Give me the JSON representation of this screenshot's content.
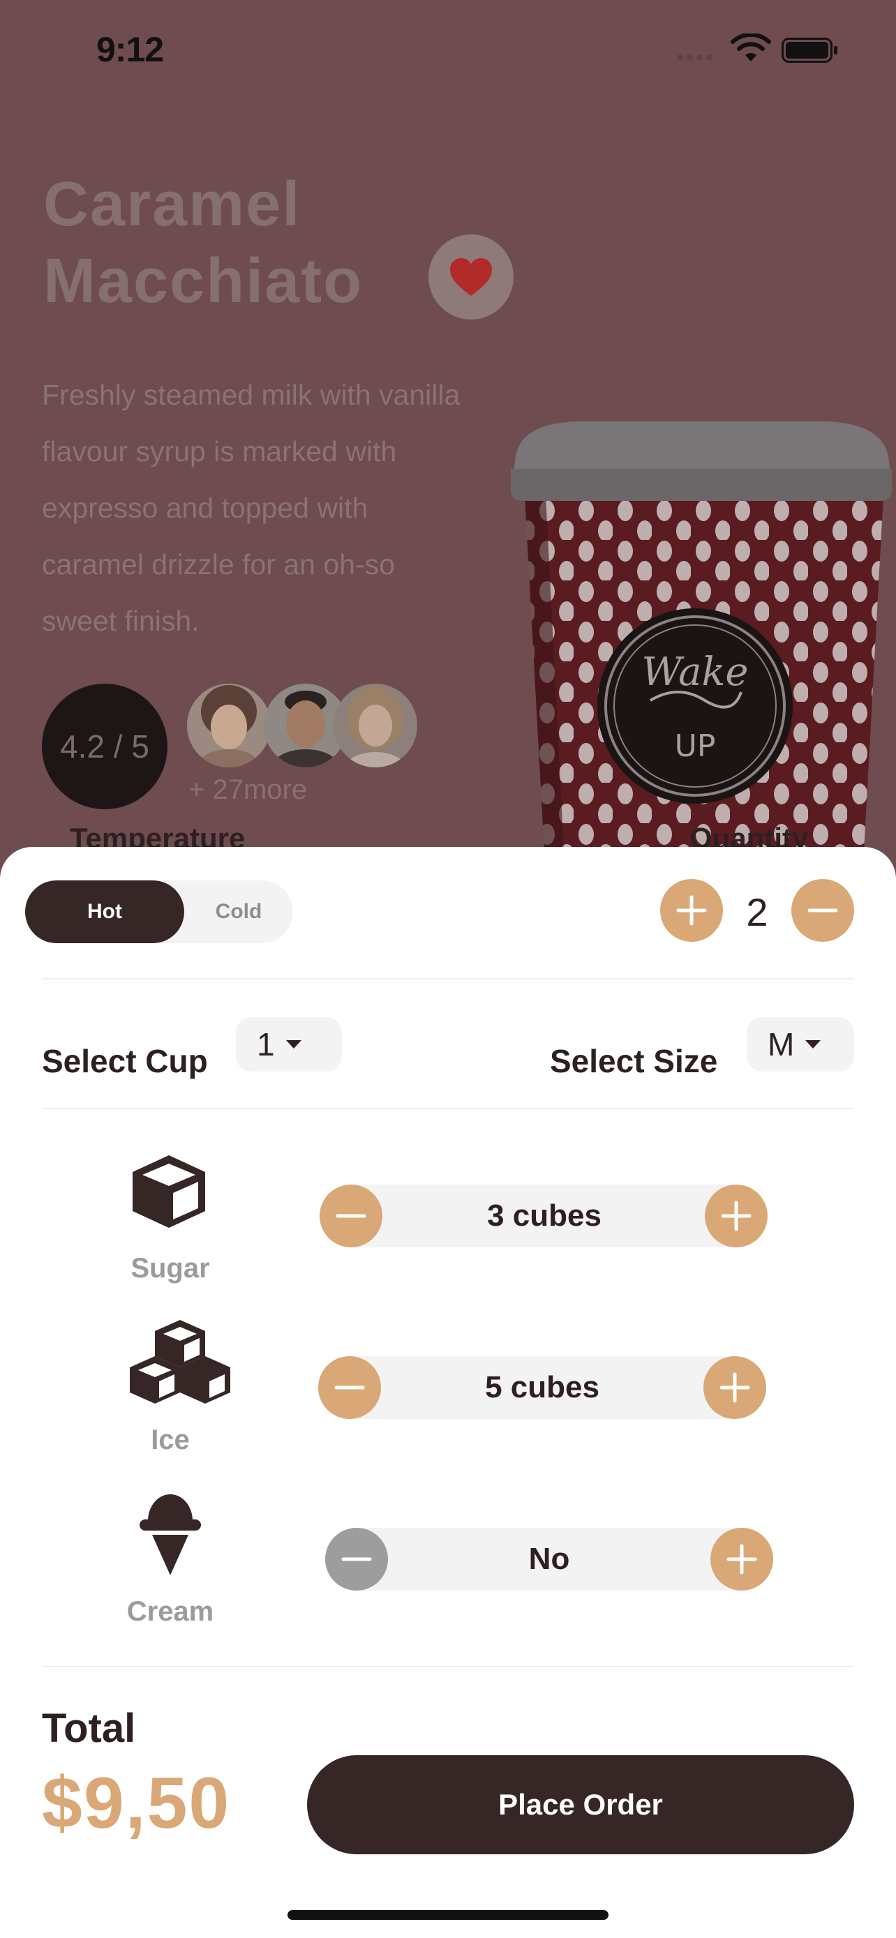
{
  "status_bar": {
    "time": "9:12"
  },
  "product": {
    "title_line1": "Caramel",
    "title_line2": "Macchiato",
    "description": "Freshly steamed milk with vanilla flavour syrup is marked with expresso and topped with caramel drizzle for an oh-so sweet finish.",
    "rating": "4.2 / 5",
    "reviewers_more": "+ 27more",
    "cup_logo_text": "Wake UP"
  },
  "options": {
    "temperature_label": "Temperature",
    "quantity_label": "Quantity",
    "temperature_options": [
      "Hot",
      "Cold"
    ],
    "temperature_selected": "Hot",
    "quantity": "2",
    "select_cup_label": "Select Cup",
    "select_cup_value": "1",
    "select_size_label": "Select Size",
    "select_size_value": "M"
  },
  "extras": [
    {
      "icon": "sugar-cube-icon",
      "label": "Sugar",
      "value": "3 cubes"
    },
    {
      "icon": "ice-cubes-icon",
      "label": "Ice",
      "value": "5 cubes"
    },
    {
      "icon": "ice-cream-icon",
      "label": "Cream",
      "value": "No"
    }
  ],
  "footer": {
    "total_label": "Total",
    "total_price": "$9,50",
    "place_order_label": "Place Order"
  },
  "colors": {
    "accent": "#d9a876",
    "dark": "#362626",
    "overlay": "#6e4c4f",
    "favorite": "#b22a2a",
    "disabled": "#9d9d9d"
  }
}
